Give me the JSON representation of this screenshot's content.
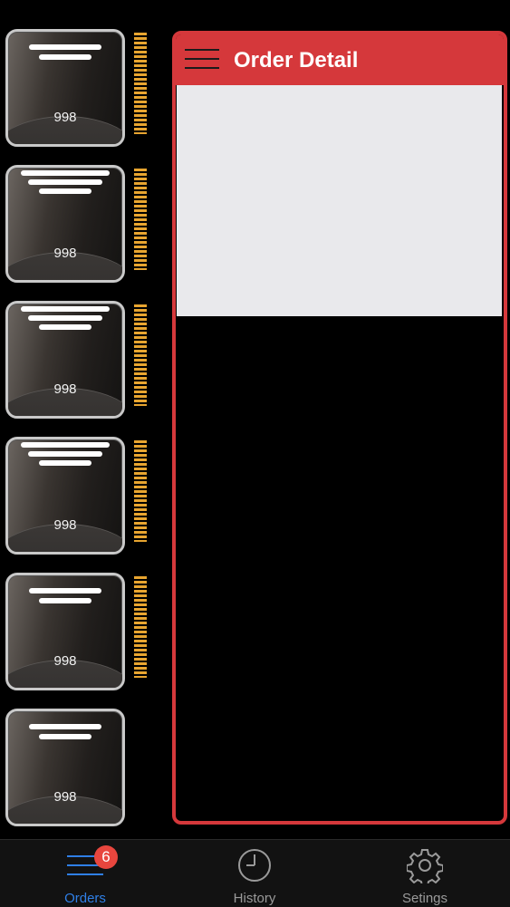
{
  "colors": {
    "accent": "#d5383b",
    "gauge": "#e8a530",
    "tab_active": "#2f7fe6",
    "badge": "#e8463e"
  },
  "queue": {
    "tickets": [
      {
        "count": "998"
      },
      {
        "count": "998"
      },
      {
        "count": "998"
      },
      {
        "count": "998"
      },
      {
        "count": "998"
      },
      {
        "count": "998"
      }
    ]
  },
  "detail": {
    "title": "Order Detail",
    "menu_icon": "hamburger-menu-icon"
  },
  "tabbar": {
    "orders": {
      "label": "Orders",
      "badge": "6",
      "icon": "list-lines-icon"
    },
    "history": {
      "label": "History",
      "icon": "clock-icon"
    },
    "settings": {
      "label": "Setings",
      "icon": "gear-icon"
    }
  }
}
